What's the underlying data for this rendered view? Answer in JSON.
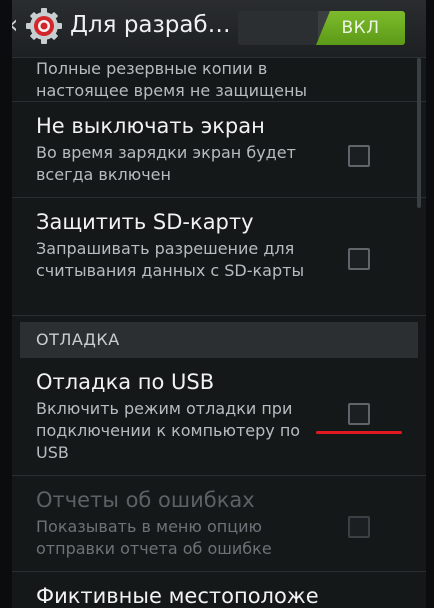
{
  "actionbar": {
    "title": "Для разраб…",
    "toggle_label": "ВКЛ"
  },
  "rows": [
    {
      "title": "",
      "subtitle": "Полные резервные копии в настоящее время не защищены"
    },
    {
      "title": "Не выключать экран",
      "subtitle": "Во время зарядки экран будет всегда включен"
    },
    {
      "title": "Защитить SD-карту",
      "subtitle": "Запрашивать разрешение для считывания данных с SD-карты"
    }
  ],
  "section": {
    "label": "ОТЛАДКА"
  },
  "debug_rows": [
    {
      "title": "Отладка по USB",
      "subtitle": "Включить режим отладки при подключении к компьютеру по USB"
    },
    {
      "title": "Отчеты об ошибках",
      "subtitle": "Показывать в меню опцию отправки отчета об ошибке"
    },
    {
      "title": "Фиктивные местоположе"
    }
  ],
  "colors": {
    "toggle_on": "#6fae22",
    "annotation_underline": "#e01a20"
  },
  "icons": {
    "back": "chevron-left-icon",
    "settings": "gear-icon"
  }
}
